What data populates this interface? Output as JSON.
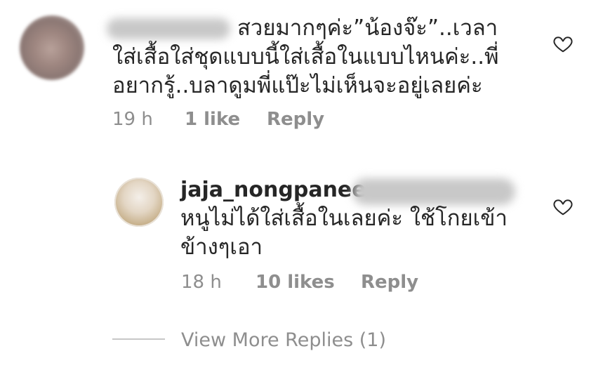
{
  "comment1": {
    "lines": [
      "สวยมากๆค่ะ”น้องจ๊ะ”..เวลา",
      "ใส่เสื้อใส่ชุดแบบนี้ใส่เสื้อในแบบไหนค่ะ..พี่",
      "อยากรู้..บลาดูมพี่แป๊ะไม่เห็นจะอยู่เลยค่ะ"
    ],
    "time": "19 h",
    "likes": "1 like",
    "reply": "Reply"
  },
  "comment2": {
    "username": "jaja_nongpanee",
    "lines": [
      "หนูไม่ได้ใส่เสื้อในเลยค่ะ ใช้โกยเข้า",
      "ข้างๆเอา"
    ],
    "time": "18 h",
    "likes": "10 likes",
    "reply": "Reply"
  },
  "view_more": "View More Replies (1)",
  "icons": {
    "like": "heart-outline-icon"
  },
  "colors": {
    "text": "#262626",
    "meta": "#8e8e8e"
  }
}
